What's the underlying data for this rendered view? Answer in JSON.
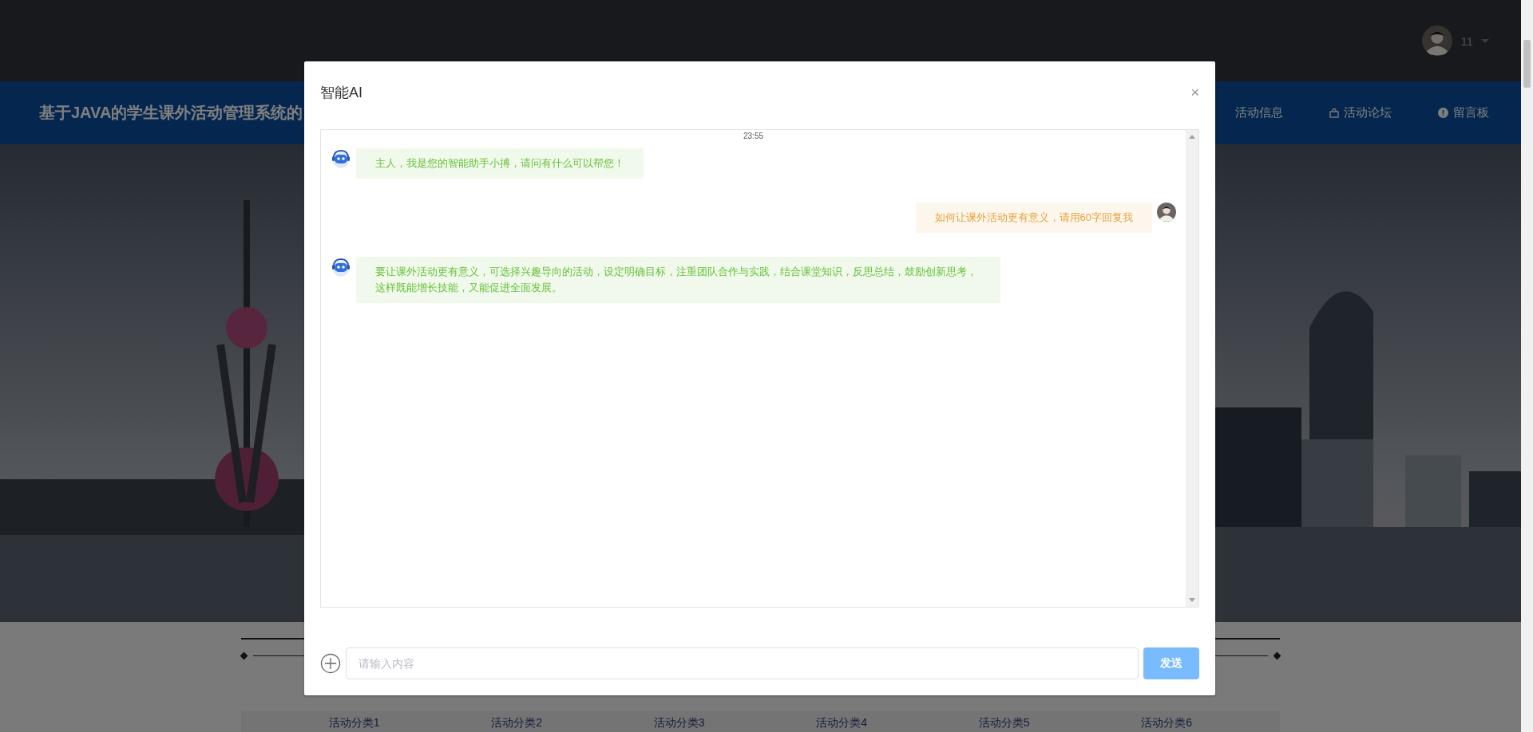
{
  "top_bar": {
    "user_name": "11"
  },
  "nav": {
    "site_title": "基于JAVA的学生课外活动管理系统的",
    "items": [
      {
        "label": "活动信息"
      },
      {
        "label": "活动论坛"
      },
      {
        "label": "留言板"
      }
    ]
  },
  "categories": [
    "活动分类1",
    "活动分类2",
    "活动分类3",
    "活动分类4",
    "活动分类5",
    "活动分类6"
  ],
  "dialog": {
    "title": "智能AI",
    "close_button": "×",
    "messages": [
      {
        "kind": "time",
        "text": "23:55"
      },
      {
        "kind": "bot",
        "text": "主人，我是您的智能助手小搏，请问有什么可以帮您！"
      },
      {
        "kind": "user",
        "text": "如何让课外活动更有意义，请用60字回复我"
      },
      {
        "kind": "bot",
        "text": "要让课外活动更有意义，可选择兴趣导向的活动，设定明确目标，注重团队合作与实践，结合课堂知识，反思总结，鼓励创新思考，这样既能增长技能，又能促进全面发展。"
      }
    ],
    "input": {
      "placeholder": "请输入内容"
    },
    "send_button": "发送"
  }
}
